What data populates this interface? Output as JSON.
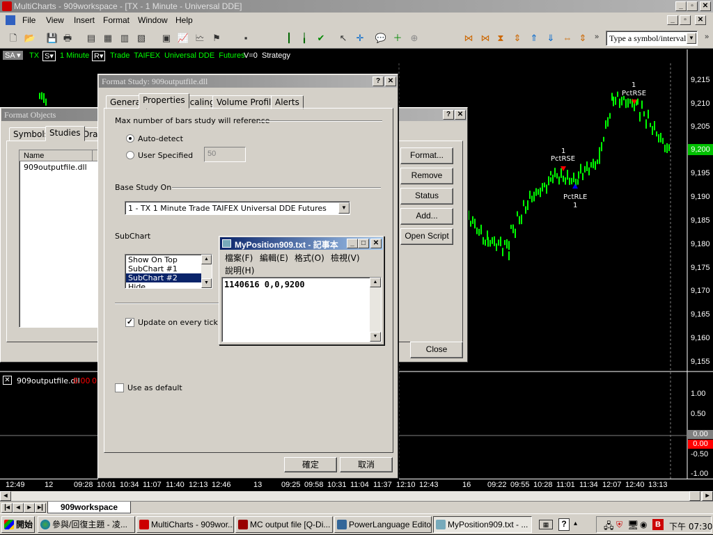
{
  "app": {
    "title": "MultiCharts - 909workspace - [TX - 1 Minute - Universal DDE]",
    "menus": [
      "File",
      "View",
      "Insert",
      "Format",
      "Window",
      "Help"
    ],
    "symbol_input_placeholder": "Type a symbol/interval"
  },
  "chart_header": {
    "sa": "SA",
    "symbol": "TX",
    "s": "S",
    "interval": "1 Minute",
    "r": "R",
    "source": "Trade  TAIFEX  Universal DDE  Futures",
    "volume": "V=0",
    "strategy": "Strategy"
  },
  "chart": {
    "price_labels": [
      "9,215",
      "9,210",
      "9,205",
      "9,195",
      "9,190",
      "9,185",
      "9,180",
      "9,175",
      "9,170",
      "9,165",
      "9,160",
      "9,155"
    ],
    "current_price": "9,200",
    "subchart_labels": [
      "1.00",
      "0.50",
      "0.00",
      "-0.50",
      "-1.00"
    ],
    "subchart_current_a": "0.00",
    "subchart_current_b": "0.00",
    "study_label": "909outputfile.dll",
    "study_value_a": "0.00",
    "study_value_b": "0.00",
    "time_labels": [
      "12:49",
      "12",
      "09:28",
      "10:01",
      "10:34",
      "11:07",
      "11:40",
      "12:13",
      "12:46",
      "13",
      "09:25",
      "09:58",
      "10:31",
      "11:04",
      "11:37",
      "12:10",
      "12:43",
      "16",
      "09:22",
      "09:55",
      "10:28",
      "11:01",
      "11:34",
      "12:07",
      "12:40",
      "13:13"
    ],
    "annotations": [
      {
        "num": "1",
        "text": "PctRSE"
      },
      {
        "num": "1",
        "text": "PctRSE"
      },
      {
        "num": "1",
        "text": "PctRLE"
      }
    ]
  },
  "format_objects": {
    "title": "Format Objects",
    "tabs": [
      "Symbols",
      "Studies",
      "Draw"
    ],
    "column_name": "Name",
    "items": [
      "909outputfile.dll"
    ],
    "buttons": [
      "Format...",
      "Remove",
      "Status",
      "Add...",
      "Open Script"
    ],
    "close": "Close"
  },
  "format_study": {
    "title": "Format Study: 909outputfile.dll",
    "tabs": [
      "General",
      "Properties",
      "Scaling",
      "Volume Profile",
      "Alerts"
    ],
    "max_bars_label": "Max number of bars study will reference",
    "auto_detect": "Auto-detect",
    "user_specified": "User Specified",
    "user_specified_value": "50",
    "base_study_label": "Base Study On",
    "base_study_value": "1 - TX 1 Minute Trade TAIFEX Universal DDE Futures",
    "subchart_label": "SubChart",
    "subchart_options": [
      "Show On Top",
      "SubChart #1",
      "SubChart #2",
      "Hide"
    ],
    "update_every_tick": "Update on every tick",
    "use_as_default": "Use as default",
    "ok": "確定",
    "cancel": "取消"
  },
  "notepad": {
    "title": "MyPosition909.txt - 記事本",
    "menus": [
      "檔案(F)",
      "編輯(E)",
      "格式(O)",
      "檢視(V)",
      "說明(H)"
    ],
    "content": "1140616 0,0,9200"
  },
  "workspace_tab": "909workspace",
  "taskbar": {
    "start": "開始",
    "items": [
      "參與/回復主題 - 凌...",
      "MultiCharts - 909wor...",
      "MC output file  [Q-Di...",
      "PowerLanguage Edito...",
      "MyPosition909.txt - ..."
    ],
    "clock": "下午 07:30"
  },
  "colors": {
    "bar_green": "#00ff00",
    "title_active": "#0a246a",
    "selection": "#0a246a",
    "marker_red": "#ff0000",
    "marker_blue": "#0000ff"
  }
}
